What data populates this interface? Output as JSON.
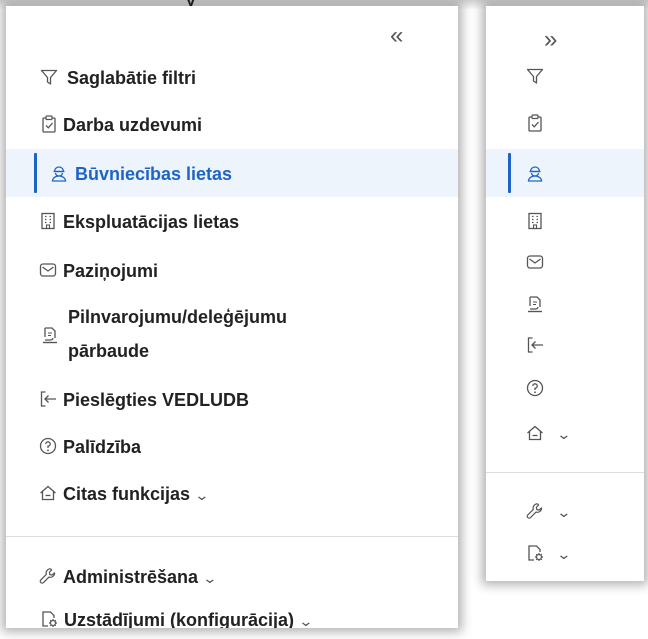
{
  "top_text": "y",
  "expanded_panel": {
    "collapse_label": "«",
    "items": [
      {
        "label": "Saglabātie filtri",
        "icon": "filter-icon"
      },
      {
        "label": "Darba uzdevumi",
        "icon": "clipboard-check-icon"
      },
      {
        "label": "Būvniecības lietas",
        "icon": "construction-worker-icon",
        "active": true
      },
      {
        "label": "Ekspluatācijas lietas",
        "icon": "building-icon"
      },
      {
        "label": "Paziņojumi",
        "icon": "envelope-icon"
      },
      {
        "label_line1": "Pilnvarojumu/deleģējumu",
        "label_line2": "pārbaude",
        "icon": "document-hand-icon"
      },
      {
        "label": "Pieslēgties VEDLUDB",
        "icon": "login-arrow-icon"
      },
      {
        "label": "Palīdzība",
        "icon": "help-circle-icon"
      },
      {
        "label": "Citas funkcijas",
        "icon": "home-icon",
        "chevron": "⌄"
      },
      {
        "label": "Administrēšana",
        "icon": "wrench-icon",
        "chevron": "⌄"
      },
      {
        "label": "Uzstādījumi (konfigurācija)",
        "icon": "settings-file-icon",
        "chevron": "⌄"
      }
    ]
  },
  "collapsed_panel": {
    "expand_label": "»",
    "chevron": "⌄"
  },
  "colors": {
    "active_text": "#1e64c8",
    "active_bg": "#eef4fb",
    "text": "#222222",
    "icon": "#555555"
  }
}
